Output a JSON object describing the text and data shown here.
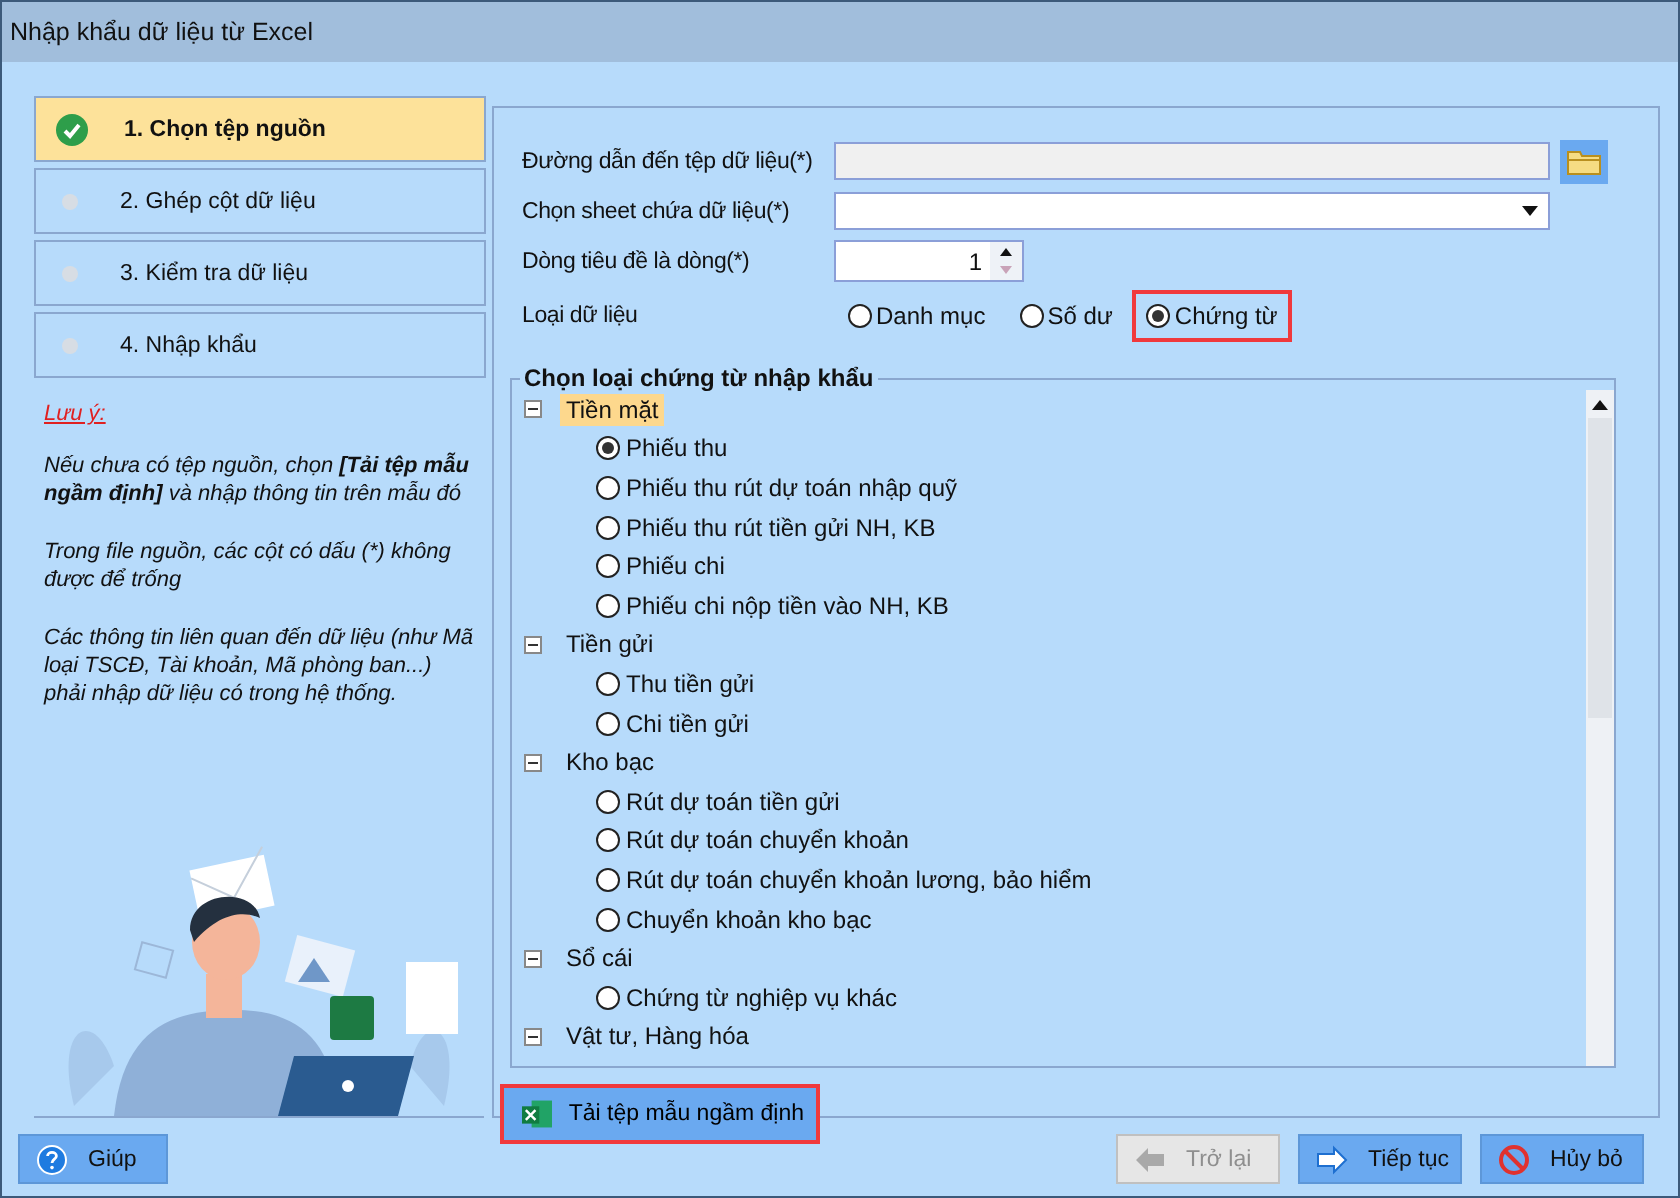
{
  "window": {
    "title": "Nhập khẩu dữ liệu từ Excel"
  },
  "steps": [
    {
      "label": "1. Chọn tệp nguồn",
      "selected": true
    },
    {
      "label": "2. Ghép cột dữ liệu",
      "selected": false
    },
    {
      "label": "3. Kiểm tra dữ liệu",
      "selected": false
    },
    {
      "label": "4. Nhập khẩu",
      "selected": false
    }
  ],
  "note": {
    "title": "Lưu ý:",
    "paragraphs": [
      "Nếu chưa có tệp nguồn, chọn **[Tải tệp mẫu ngầm định]** và nhập thông tin trên mẫu đó",
      "Trong file nguồn, các cột có dấu (*) không được để trống",
      "Các thông tin liên quan đến dữ liệu (như Mã loại TSCĐ, Tài khoản, Mã phòng ban...) phải nhập dữ liệu có trong hệ thống."
    ]
  },
  "form": {
    "file_path": {
      "label": "Đường dẫn đến tệp dữ liệu(*)"
    },
    "sheet": {
      "label": "Chọn sheet chứa dữ liệu(*)"
    },
    "header_row": {
      "label": "Dòng tiêu đề là dòng(*)",
      "value": "1"
    },
    "data_type": {
      "label": "Loại dữ liệu",
      "options": [
        {
          "label": "Danh mục",
          "selected": false,
          "highlighted": false
        },
        {
          "label": "Số dư",
          "selected": false,
          "highlighted": false
        },
        {
          "label": "Chứng từ",
          "selected": true,
          "highlighted": true
        }
      ]
    }
  },
  "voucher_group": {
    "title": "Chọn loại chứng từ nhập khẩu",
    "tree": [
      {
        "label": "Tiền mặt",
        "selected": true,
        "expanded": true,
        "children": [
          {
            "label": "Phiếu thu",
            "selected": true
          },
          {
            "label": "Phiếu thu rút dự toán nhập quỹ",
            "selected": false
          },
          {
            "label": "Phiếu thu rút tiền gửi NH, KB",
            "selected": false
          },
          {
            "label": "Phiếu chi",
            "selected": false
          },
          {
            "label": "Phiếu chi nộp tiền vào NH, KB",
            "selected": false
          }
        ]
      },
      {
        "label": "Tiền gửi",
        "selected": false,
        "expanded": true,
        "children": [
          {
            "label": "Thu tiền gửi",
            "selected": false
          },
          {
            "label": "Chi tiền gửi",
            "selected": false
          }
        ]
      },
      {
        "label": "Kho bạc",
        "selected": false,
        "expanded": true,
        "children": [
          {
            "label": "Rút dự toán tiền gửi",
            "selected": false
          },
          {
            "label": "Rút dự toán chuyển khoản",
            "selected": false
          },
          {
            "label": "Rút dự toán chuyển khoản lương, bảo hiểm",
            "selected": false
          },
          {
            "label": "Chuyển khoản kho bạc",
            "selected": false
          }
        ]
      },
      {
        "label": "Sổ cái",
        "selected": false,
        "expanded": true,
        "children": [
          {
            "label": "Chứng từ nghiệp vụ khác",
            "selected": false
          }
        ]
      },
      {
        "label": "Vật tư, Hàng hóa",
        "selected": false,
        "expanded": true
      }
    ]
  },
  "template_button": {
    "label": "Tải tệp mẫu ngầm định",
    "highlighted": true
  },
  "buttons": [
    {
      "kind": "help",
      "label": "Giúp",
      "disabled": false
    },
    {
      "kind": "back",
      "label": "Trở lại",
      "disabled": true
    },
    {
      "kind": "next",
      "label": "Tiếp tục",
      "disabled": false
    },
    {
      "kind": "cancel",
      "label": "Hủy bỏ",
      "disabled": false
    }
  ]
}
